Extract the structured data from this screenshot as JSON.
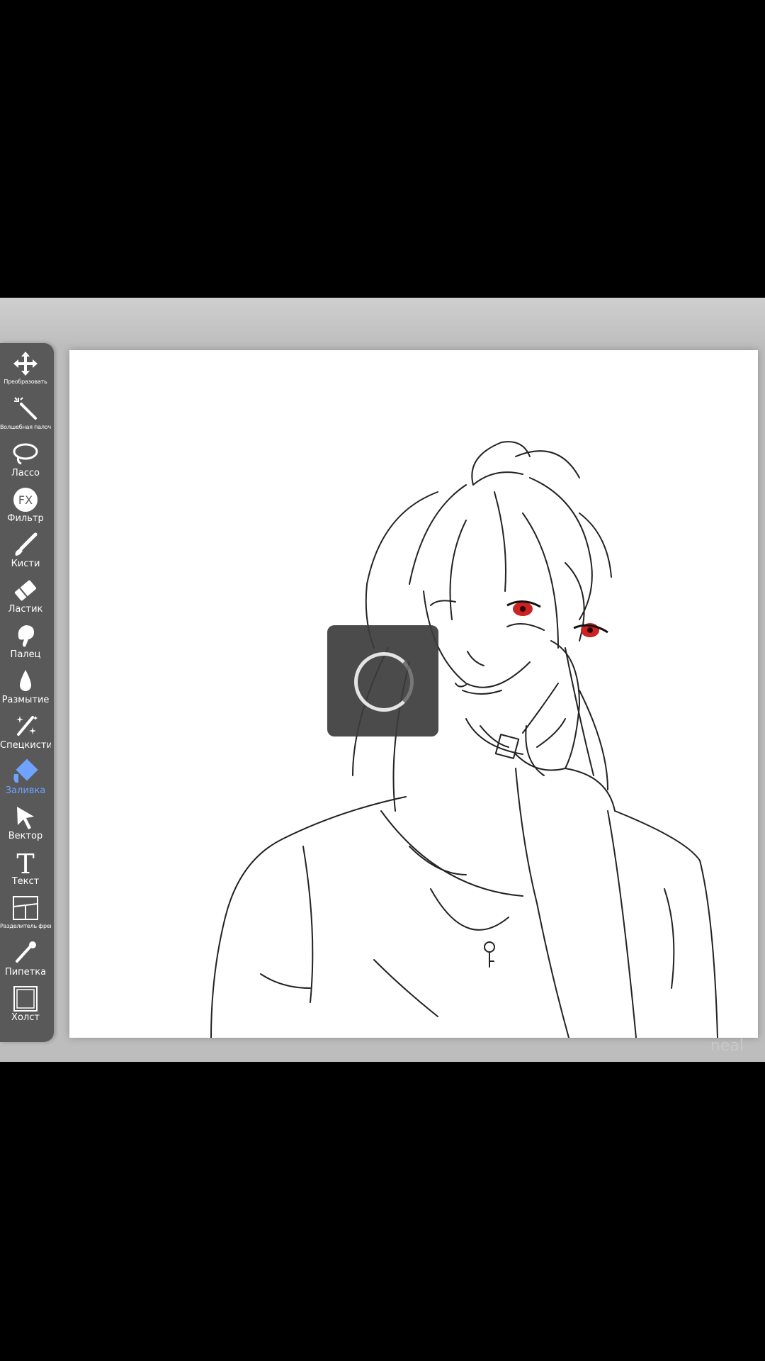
{
  "toolbar": {
    "tools": [
      {
        "label": "Преобразовать",
        "icon": "move-icon"
      },
      {
        "label": "Волшебная палочка",
        "icon": "magic-wand-icon"
      },
      {
        "label": "Лассо",
        "icon": "lasso-icon"
      },
      {
        "label": "Фильтр",
        "icon": "fx-icon",
        "icon_text": "FX"
      },
      {
        "label": "Кисти",
        "icon": "brush-icon"
      },
      {
        "label": "Ластик",
        "icon": "eraser-icon"
      },
      {
        "label": "Палец",
        "icon": "finger-icon"
      },
      {
        "label": "Размытие",
        "icon": "blur-drop-icon"
      },
      {
        "label": "Спецкисти",
        "icon": "special-brush-icon"
      },
      {
        "label": "Заливка",
        "icon": "fill-icon",
        "active": true
      },
      {
        "label": "Вектор",
        "icon": "vector-cursor-icon"
      },
      {
        "label": "Текст",
        "icon": "text-icon",
        "icon_text": "T"
      },
      {
        "label": "Разделитель фреймов",
        "icon": "frame-divider-icon"
      },
      {
        "label": "Пипетка",
        "icon": "eyedropper-icon"
      },
      {
        "label": "Холст",
        "icon": "canvas-icon"
      }
    ]
  },
  "canvas": {
    "watermark": "neal"
  },
  "colors": {
    "background": "#000000",
    "app_background": "#bdbdbd",
    "toolbar": "#595959",
    "active_tool": "#6fa3ff",
    "canvas": "#ffffff",
    "overlay": "#3c3c3c",
    "eye_color": "#cc2222"
  }
}
